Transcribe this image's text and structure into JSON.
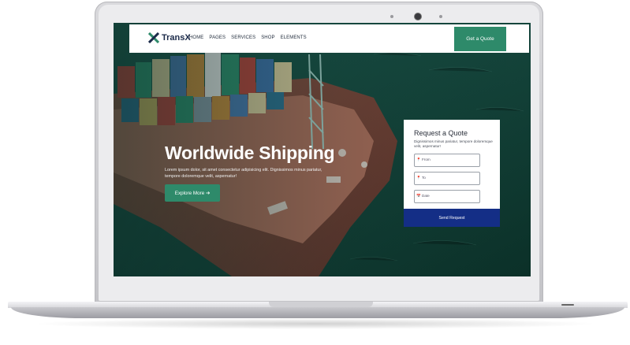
{
  "brand": {
    "name": "TransX",
    "icon": "x-logo-icon"
  },
  "nav": {
    "items": [
      "HOME",
      "PAGES",
      "SERVICES",
      "SHOP",
      "ELEMENTS"
    ],
    "cta": "Get a Quote"
  },
  "hero": {
    "title": "Worldwide Shipping",
    "subtitle": "Lorem ipsum dolor, sit amet consectetur adipisicing elit. Dignissimos minus pariatur, tempore doloremque velit, aspernatur!",
    "button": "Explore More ➔"
  },
  "quote_form": {
    "title": "Request a Quote",
    "description": "Dignissimos minus pariatur, tempore doloremque velit, aspernatur!",
    "from_placeholder": "From",
    "to_placeholder": "To",
    "date_placeholder": "Date",
    "submit": "Send Request",
    "pin_icon": "📍",
    "calendar_icon": "📅"
  },
  "colors": {
    "accent_green": "#2e8a6a",
    "submit_blue": "#142e86",
    "sea": "#0f3b33",
    "hull": "#8a4a3e"
  }
}
